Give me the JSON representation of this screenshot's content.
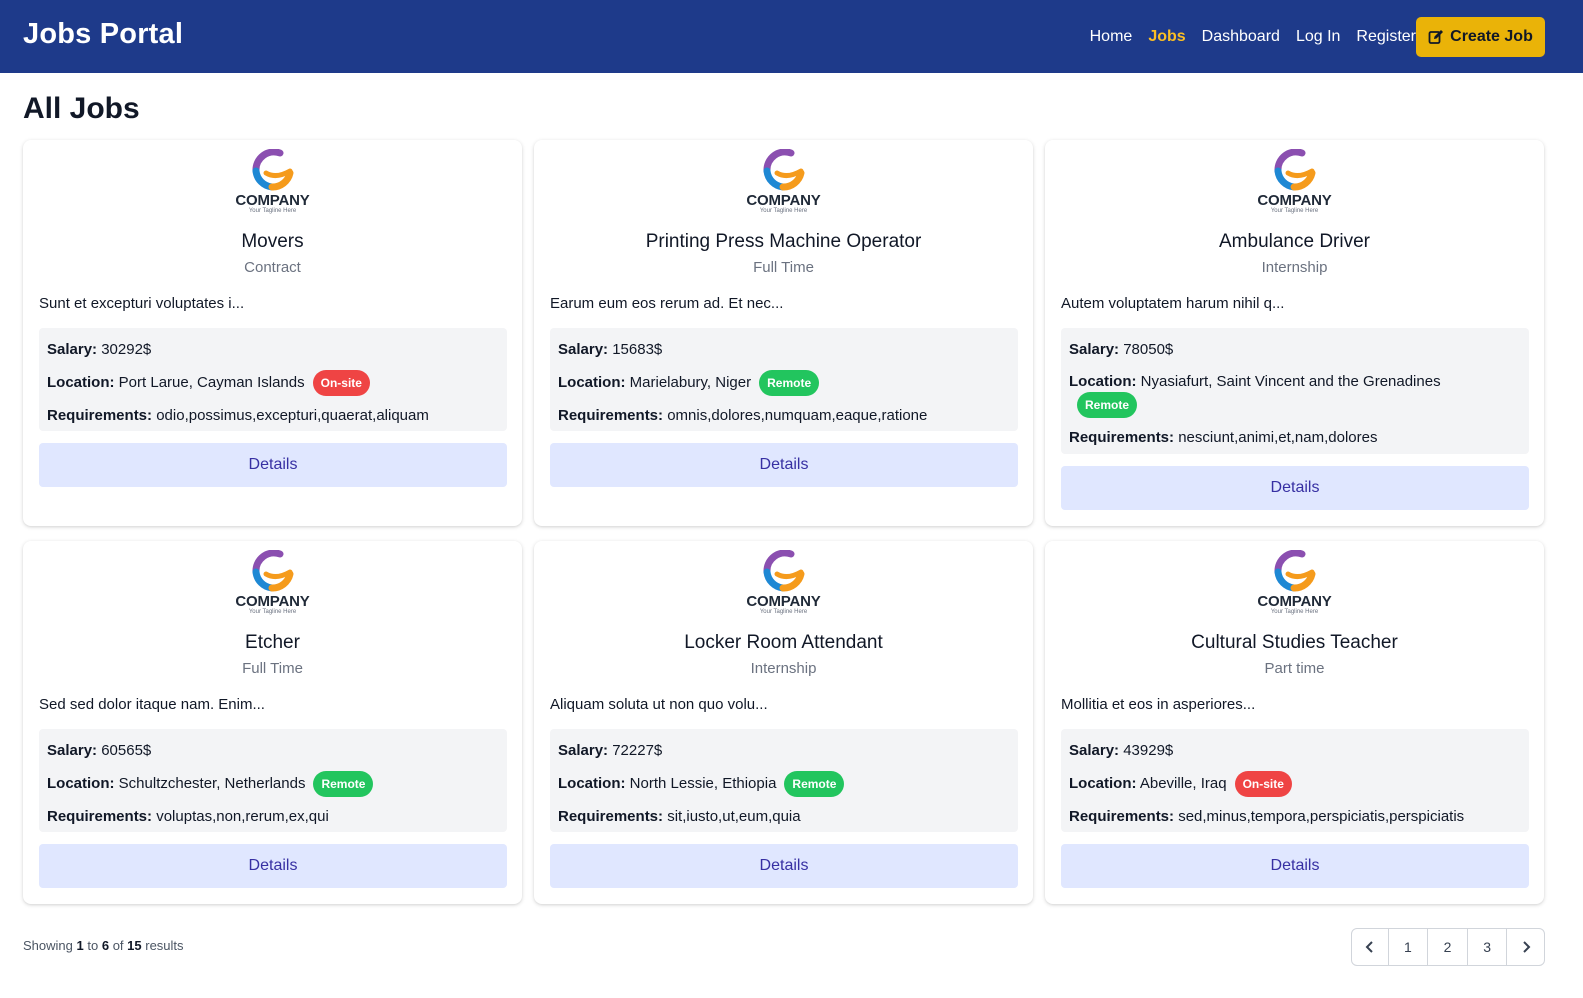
{
  "navbar": {
    "brand": "Jobs Portal",
    "links": [
      "Home",
      "Jobs",
      "Dashboard",
      "Log In",
      "Register"
    ],
    "active_link": "Jobs",
    "create_label": "Create Job",
    "create_icon": "edit-icon"
  },
  "page": {
    "title": "All Jobs"
  },
  "labels": {
    "salary": "Salary:",
    "location": "Location:",
    "requirements": "Requirements:",
    "details": "Details"
  },
  "company_logo": {
    "name": "COMPANY",
    "tagline": "Your Tagline Here"
  },
  "jobs": [
    {
      "title": "Movers",
      "type": "Contract",
      "description": "Sunt et excepturi voluptates i...",
      "salary": "30292$",
      "location": "Port Larue, Cayman Islands",
      "mode": "On-site",
      "requirements": "odio,possimus,excepturi,quaerat,aliquam"
    },
    {
      "title": "Printing Press Machine Operator",
      "type": "Full Time",
      "description": "Earum eum eos rerum ad. Et nec...",
      "salary": "15683$",
      "location": "Marielabury, Niger",
      "mode": "Remote",
      "requirements": "omnis,dolores,numquam,eaque,ratione"
    },
    {
      "title": "Ambulance Driver",
      "type": "Internship",
      "description": "Autem voluptatem harum nihil q...",
      "salary": "78050$",
      "location": "Nyasiafurt, Saint Vincent and the Grenadines",
      "mode": "Remote",
      "requirements": "nesciunt,animi,et,nam,dolores"
    },
    {
      "title": "Etcher",
      "type": "Full Time",
      "description": "Sed sed dolor itaque nam. Enim...",
      "salary": "60565$",
      "location": "Schultzchester, Netherlands",
      "mode": "Remote",
      "requirements": "voluptas,non,rerum,ex,qui"
    },
    {
      "title": "Locker Room Attendant",
      "type": "Internship",
      "description": "Aliquam soluta ut non quo volu...",
      "salary": "72227$",
      "location": "North Lessie, Ethiopia",
      "mode": "Remote",
      "requirements": "sit,iusto,ut,eum,quia"
    },
    {
      "title": "Cultural Studies Teacher",
      "type": "Part time",
      "description": "Mollitia et eos in asperiores...",
      "salary": "43929$",
      "location": "Abeville, Iraq",
      "mode": "On-site",
      "requirements": "sed,minus,tempora,perspiciatis,perspiciatis"
    }
  ],
  "pagination": {
    "showing_prefix": "Showing",
    "from": "1",
    "to_word": "to",
    "to": "6",
    "of_word": "of",
    "total": "15",
    "results_word": "results",
    "pages": [
      "1",
      "2",
      "3"
    ],
    "prev_icon": "chevron-left-icon",
    "next_icon": "chevron-right-icon"
  },
  "colors": {
    "navbar_bg": "#1e3a8a",
    "accent": "#eab308",
    "remote_badge": "#22c55e",
    "onsite_badge": "#ef4444",
    "details_bg": "#e0e7ff"
  }
}
